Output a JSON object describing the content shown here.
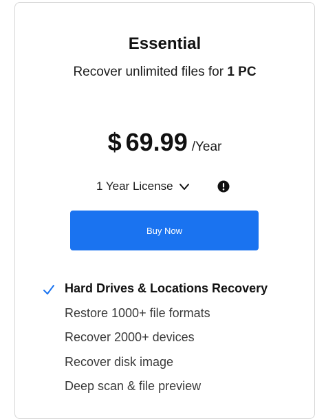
{
  "plan": {
    "name": "Essential",
    "subtitle_prefix": "Recover unlimited files for ",
    "subtitle_bold": "1 PC"
  },
  "price": {
    "currency": "$",
    "amount": "69.99",
    "period": "/Year"
  },
  "license": {
    "selected": "1 Year License",
    "dropdown_icon": "chevron-down-icon",
    "info_icon": "info-icon"
  },
  "buy_button": {
    "label": "Buy Now",
    "color": "#1a73f0"
  },
  "features": [
    {
      "text": "Hard Drives & Locations Recovery",
      "checked": true,
      "highlighted": true
    },
    {
      "text": "Restore 1000+ file formats",
      "checked": false,
      "highlighted": false
    },
    {
      "text": "Recover 2000+ devices",
      "checked": false,
      "highlighted": false
    },
    {
      "text": "Recover disk image",
      "checked": false,
      "highlighted": false
    },
    {
      "text": "Deep scan & file preview",
      "checked": false,
      "highlighted": false
    }
  ],
  "colors": {
    "accent": "#1a73f0",
    "check": "#1a73f0",
    "border": "#d6d6d6"
  }
}
